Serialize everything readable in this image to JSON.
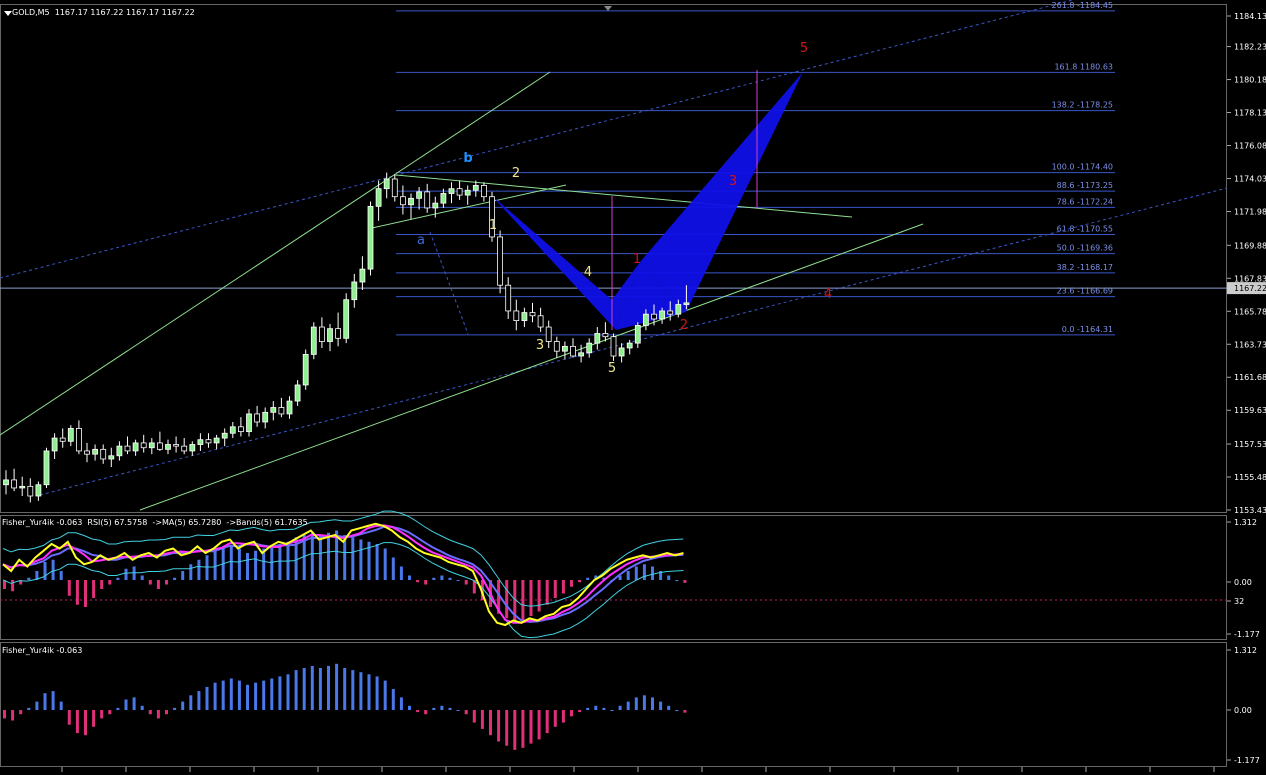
{
  "header": {
    "symbol": "GOLD,M5",
    "ohlc": "1167.17 1167.22 1167.17 1167.22"
  },
  "price_axis": {
    "ticks": [
      "1184.13",
      "1182.23",
      "1180.18",
      "1178.13",
      "1176.08",
      "1174.03",
      "1171.98",
      "1169.88",
      "1167.83",
      "1165.78",
      "1163.73",
      "1161.68",
      "1159.63",
      "1157.53",
      "1155.48",
      "1153.43"
    ],
    "current": "1167.22"
  },
  "fib_levels": [
    {
      "label": "261.8 -1184.45",
      "value": 1184.45
    },
    {
      "label": "161.8 1180.63",
      "value": 1180.63
    },
    {
      "label": "138.2 -1178.25",
      "value": 1178.25
    },
    {
      "label": "100.0 -1174.40",
      "value": 1174.4
    },
    {
      "label": "88.6 -1173.25",
      "value": 1173.25
    },
    {
      "label": "78.6 -1172.24",
      "value": 1172.24
    },
    {
      "label": "61.8 -1170.55",
      "value": 1170.55
    },
    {
      "label": "50.0 -1169.36",
      "value": 1169.36
    },
    {
      "label": "38.2 -1168.17",
      "value": 1168.17
    },
    {
      "label": "23.6 -1166.69",
      "value": 1166.69
    },
    {
      "label": "0.0 -1164.31",
      "value": 1164.31
    }
  ],
  "wave_labels": [
    {
      "text": "b",
      "color": "#1e90ff"
    },
    {
      "text": "a",
      "color": "#3a6bd8"
    },
    {
      "text": "1",
      "color": "#f0e68c"
    },
    {
      "text": "2",
      "color": "#f0e68c"
    },
    {
      "text": "3",
      "color": "#f0e68c"
    },
    {
      "text": "4",
      "color": "#f0e68c"
    },
    {
      "text": "5",
      "color": "#f0e68c"
    },
    {
      "text": "1",
      "color": "#d01515"
    },
    {
      "text": "2",
      "color": "#d01515"
    },
    {
      "text": "3",
      "color": "#d01515"
    },
    {
      "text": "4",
      "color": "#d01515"
    },
    {
      "text": "5",
      "color": "#d01515"
    }
  ],
  "indicator1": {
    "title": "Fisher_Yur4ik -0.063  RSI(5) 67.5758  ->MA(5) 65.7280  ->Bands(5) 61.7635",
    "ticks": [
      "1.312",
      "0.00",
      "32",
      "-1.177"
    ]
  },
  "indicator2": {
    "title": "Fisher_Yur4ik -0.063",
    "ticks": [
      "1.312",
      "0.00",
      "-1.177"
    ]
  },
  "chart_data": {
    "type": "candlestick",
    "symbol": "GOLD",
    "timeframe": "M5",
    "ylim": [
      1153.43,
      1185.2
    ],
    "candles": [
      [
        1155.0,
        1155.9,
        1154.4,
        1155.3
      ],
      [
        1155.3,
        1156.0,
        1154.6,
        1154.8
      ],
      [
        1154.8,
        1155.5,
        1154.3,
        1154.9
      ],
      [
        1154.9,
        1155.4,
        1153.9,
        1154.3
      ],
      [
        1154.3,
        1155.2,
        1154.0,
        1155.0
      ],
      [
        1155.0,
        1157.3,
        1154.8,
        1157.1
      ],
      [
        1157.1,
        1158.2,
        1156.6,
        1157.9
      ],
      [
        1157.9,
        1158.5,
        1157.3,
        1157.7
      ],
      [
        1157.7,
        1158.7,
        1157.4,
        1158.5
      ],
      [
        1158.5,
        1159.0,
        1156.9,
        1157.1
      ],
      [
        1157.1,
        1157.6,
        1156.4,
        1156.9
      ],
      [
        1156.9,
        1157.5,
        1156.5,
        1157.2
      ],
      [
        1157.2,
        1157.5,
        1156.3,
        1156.6
      ],
      [
        1156.6,
        1157.3,
        1156.1,
        1156.8
      ],
      [
        1156.8,
        1157.7,
        1156.5,
        1157.4
      ],
      [
        1157.4,
        1158.0,
        1156.9,
        1157.1
      ],
      [
        1157.1,
        1157.8,
        1156.8,
        1157.6
      ],
      [
        1157.6,
        1158.1,
        1157.0,
        1157.3
      ],
      [
        1157.3,
        1157.9,
        1156.9,
        1157.6
      ],
      [
        1157.6,
        1158.3,
        1157.1,
        1157.2
      ],
      [
        1157.2,
        1157.8,
        1156.9,
        1157.5
      ],
      [
        1157.5,
        1158.0,
        1157.0,
        1157.4
      ],
      [
        1157.4,
        1157.9,
        1156.9,
        1157.1
      ],
      [
        1157.1,
        1157.7,
        1156.8,
        1157.5
      ],
      [
        1157.5,
        1158.2,
        1157.1,
        1157.8
      ],
      [
        1157.8,
        1158.2,
        1157.3,
        1157.6
      ],
      [
        1157.6,
        1158.1,
        1157.2,
        1157.9
      ],
      [
        1157.9,
        1158.5,
        1157.4,
        1158.2
      ],
      [
        1158.2,
        1158.9,
        1157.9,
        1158.6
      ],
      [
        1158.6,
        1159.2,
        1158.0,
        1158.3
      ],
      [
        1158.3,
        1159.7,
        1158.0,
        1159.4
      ],
      [
        1159.4,
        1159.9,
        1158.6,
        1158.9
      ],
      [
        1158.9,
        1159.8,
        1158.5,
        1159.5
      ],
      [
        1159.5,
        1160.2,
        1159.0,
        1159.8
      ],
      [
        1159.8,
        1160.4,
        1159.2,
        1159.4
      ],
      [
        1159.4,
        1160.5,
        1159.1,
        1160.2
      ],
      [
        1160.2,
        1161.5,
        1159.9,
        1161.2
      ],
      [
        1161.2,
        1163.4,
        1160.9,
        1163.1
      ],
      [
        1163.1,
        1165.1,
        1162.8,
        1164.8
      ],
      [
        1164.8,
        1165.4,
        1163.5,
        1163.9
      ],
      [
        1163.9,
        1165.0,
        1163.3,
        1164.7
      ],
      [
        1164.7,
        1165.7,
        1163.6,
        1164.1
      ],
      [
        1164.1,
        1166.9,
        1163.8,
        1166.5
      ],
      [
        1166.5,
        1168.1,
        1166.0,
        1167.6
      ],
      [
        1167.6,
        1169.2,
        1167.1,
        1168.4
      ],
      [
        1168.4,
        1172.6,
        1168.0,
        1172.3
      ],
      [
        1172.3,
        1173.9,
        1171.4,
        1173.4
      ],
      [
        1173.4,
        1174.4,
        1172.8,
        1174.0
      ],
      [
        1174.0,
        1174.3,
        1172.6,
        1172.9
      ],
      [
        1172.9,
        1173.6,
        1171.8,
        1172.4
      ],
      [
        1172.4,
        1173.1,
        1171.5,
        1172.8
      ],
      [
        1172.8,
        1173.5,
        1172.1,
        1173.2
      ],
      [
        1173.2,
        1173.7,
        1171.9,
        1172.2
      ],
      [
        1172.2,
        1172.9,
        1171.6,
        1172.5
      ],
      [
        1172.5,
        1173.4,
        1172.2,
        1173.1
      ],
      [
        1173.1,
        1173.8,
        1172.5,
        1173.4
      ],
      [
        1173.4,
        1173.9,
        1172.7,
        1173.0
      ],
      [
        1173.0,
        1173.6,
        1172.4,
        1173.3
      ],
      [
        1173.3,
        1173.9,
        1172.9,
        1173.6
      ],
      [
        1173.6,
        1173.8,
        1172.6,
        1172.9
      ],
      [
        1172.9,
        1173.2,
        1170.1,
        1170.4
      ],
      [
        1170.4,
        1170.8,
        1166.9,
        1167.4
      ],
      [
        1167.4,
        1167.9,
        1165.3,
        1165.8
      ],
      [
        1165.8,
        1166.5,
        1164.6,
        1165.2
      ],
      [
        1165.2,
        1166.0,
        1164.8,
        1165.7
      ],
      [
        1165.7,
        1166.3,
        1165.1,
        1165.5
      ],
      [
        1165.5,
        1166.0,
        1164.5,
        1164.8
      ],
      [
        1164.8,
        1165.2,
        1163.5,
        1163.9
      ],
      [
        1163.9,
        1164.2,
        1162.9,
        1163.3
      ],
      [
        1163.3,
        1163.9,
        1162.8,
        1163.6
      ],
      [
        1163.6,
        1164.1,
        1162.9,
        1163.0
      ],
      [
        1163.0,
        1163.7,
        1162.6,
        1163.2
      ],
      [
        1163.2,
        1164.1,
        1162.9,
        1163.8
      ],
      [
        1163.8,
        1164.8,
        1163.4,
        1164.4
      ],
      [
        1164.4,
        1165.1,
        1163.9,
        1164.2
      ],
      [
        1164.2,
        1164.4,
        1162.7,
        1163.0
      ],
      [
        1163.0,
        1163.8,
        1162.6,
        1163.5
      ],
      [
        1163.5,
        1164.0,
        1163.1,
        1163.8
      ],
      [
        1163.8,
        1165.1,
        1163.5,
        1164.9
      ],
      [
        1164.9,
        1165.9,
        1164.6,
        1165.6
      ],
      [
        1165.6,
        1166.2,
        1164.9,
        1165.3
      ],
      [
        1165.3,
        1166.0,
        1165.0,
        1165.8
      ],
      [
        1165.8,
        1166.4,
        1165.2,
        1165.6
      ],
      [
        1165.6,
        1166.5,
        1165.4,
        1166.2
      ],
      [
        1166.2,
        1167.4,
        1165.9,
        1166.3
      ]
    ],
    "rsi_series": [
      0.35,
      0.2,
      0.45,
      0.3,
      0.5,
      0.65,
      0.8,
      0.7,
      0.85,
      0.5,
      0.35,
      0.4,
      0.55,
      0.45,
      0.5,
      0.6,
      0.45,
      0.55,
      0.6,
      0.5,
      0.65,
      0.7,
      0.55,
      0.6,
      0.75,
      0.6,
      0.7,
      0.85,
      0.9,
      0.7,
      0.8,
      0.85,
      0.6,
      0.75,
      0.85,
      0.8,
      0.9,
      1.0,
      1.1,
      0.9,
      0.95,
      1.0,
      0.85,
      1.1,
      1.15,
      1.2,
      1.25,
      1.2,
      1.1,
      0.95,
      0.85,
      0.7,
      0.6,
      0.55,
      0.5,
      0.4,
      0.35,
      0.3,
      0.2,
      -0.2,
      -0.7,
      -0.95,
      -1.0,
      -0.9,
      -0.95,
      -0.85,
      -0.9,
      -0.8,
      -0.75,
      -0.6,
      -0.55,
      -0.4,
      -0.2,
      0.0,
      0.1,
      0.25,
      0.35,
      0.45,
      0.5,
      0.55,
      0.5,
      0.55,
      0.6,
      0.55,
      0.6
    ],
    "fisher_series": [
      -0.2,
      -0.25,
      -0.1,
      0.05,
      0.2,
      0.4,
      0.45,
      0.2,
      -0.35,
      -0.55,
      -0.6,
      -0.4,
      -0.2,
      -0.1,
      0.05,
      0.25,
      0.3,
      0.1,
      -0.1,
      -0.2,
      -0.1,
      0.05,
      0.2,
      0.35,
      0.45,
      0.55,
      0.65,
      0.7,
      0.75,
      0.7,
      0.6,
      0.65,
      0.7,
      0.75,
      0.8,
      0.85,
      0.95,
      1.0,
      1.05,
      1.0,
      1.05,
      1.1,
      1.0,
      0.95,
      0.9,
      0.85,
      0.8,
      0.7,
      0.5,
      0.3,
      0.1,
      -0.05,
      -0.1,
      0.05,
      0.1,
      0.05,
      0.0,
      -0.1,
      -0.3,
      -0.45,
      -0.6,
      -0.75,
      -0.85,
      -0.95,
      -0.9,
      -0.8,
      -0.7,
      -0.55,
      -0.4,
      -0.3,
      -0.15,
      -0.05,
      0.05,
      0.1,
      0.05,
      0.0,
      0.1,
      0.2,
      0.3,
      0.35,
      0.3,
      0.2,
      0.1,
      0.0,
      -0.063
    ]
  }
}
